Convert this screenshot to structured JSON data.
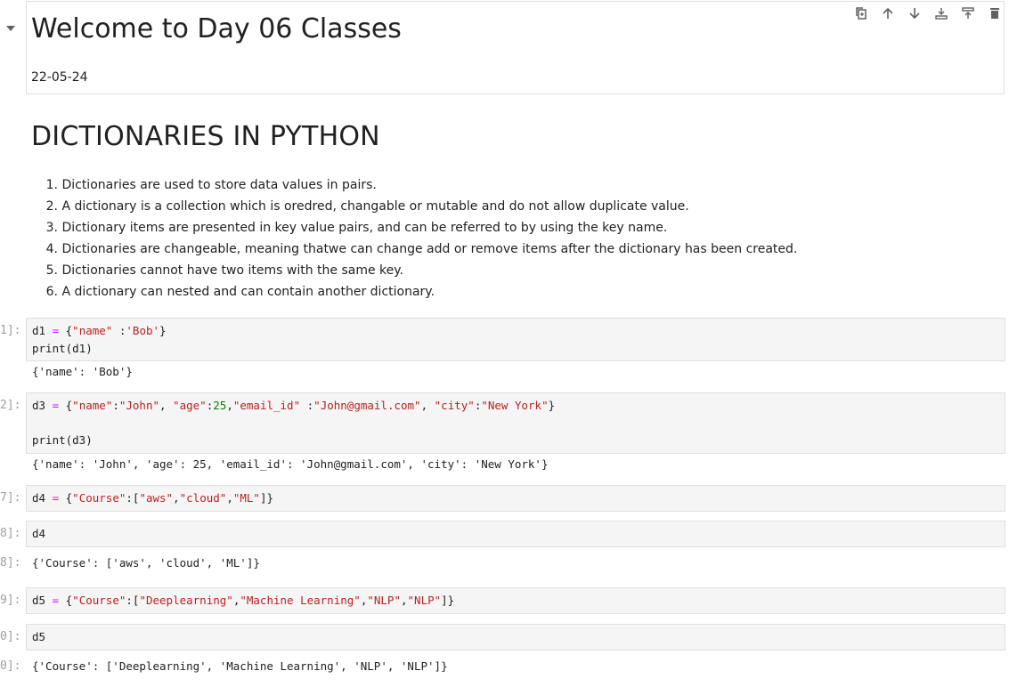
{
  "markdown_cell": {
    "title": "Welcome to Day 06 Classes",
    "date": "22-05-24"
  },
  "toolbar_icons": [
    "duplicate-icon",
    "move-up-icon",
    "move-down-icon",
    "insert-above-icon",
    "insert-below-icon",
    "delete-icon"
  ],
  "section": {
    "heading": "DICTIONARIES IN PYTHON",
    "points": [
      {
        "n": "1.",
        "text": "Dictionaries are used to store data values in pairs."
      },
      {
        "n": "2.",
        "text": "A dictionary is a collection which is oredred, changable or mutable and do not allow duplicate value."
      },
      {
        "n": "3.",
        "text": "Dictionary items are presented in key value pairs, and can be referred to by using the key name."
      },
      {
        "n": "4.",
        "text": "Dictionaries are changeable, meaning thatwe can change add or remove items after the dictionary has been created."
      },
      {
        "n": "5.",
        "text": "Dictionaries cannot have two items with the same key."
      },
      {
        "n": "6.",
        "text": "A dictionary can nested and can contain another dictionary."
      }
    ]
  },
  "cells": [
    {
      "prompt": "1]:",
      "out_prompt": "",
      "code": [
        [
          {
            "t": "d1 ",
            "c": "p"
          },
          {
            "t": "=",
            "c": "o"
          },
          {
            "t": " {",
            "c": "p"
          },
          {
            "t": "\"name\"",
            "c": "s"
          },
          {
            "t": " :",
            "c": "p"
          },
          {
            "t": "'Bob'",
            "c": "s"
          },
          {
            "t": "}",
            "c": "p"
          }
        ],
        [
          {
            "t": "print(d1)",
            "c": "p"
          }
        ]
      ],
      "output": "{'name': 'Bob'}"
    },
    {
      "prompt": "2]:",
      "out_prompt": "",
      "code": [
        [
          {
            "t": "d3 ",
            "c": "p"
          },
          {
            "t": "=",
            "c": "o"
          },
          {
            "t": " {",
            "c": "p"
          },
          {
            "t": "\"name\"",
            "c": "s"
          },
          {
            "t": ":",
            "c": "p"
          },
          {
            "t": "\"John\"",
            "c": "s"
          },
          {
            "t": ", ",
            "c": "p"
          },
          {
            "t": "\"age\"",
            "c": "s"
          },
          {
            "t": ":",
            "c": "p"
          },
          {
            "t": "25",
            "c": "n"
          },
          {
            "t": ",",
            "c": "p"
          },
          {
            "t": "\"email_id\"",
            "c": "s"
          },
          {
            "t": " :",
            "c": "p"
          },
          {
            "t": "\"John@gmail.com\"",
            "c": "s"
          },
          {
            "t": ", ",
            "c": "p"
          },
          {
            "t": "\"city\"",
            "c": "s"
          },
          {
            "t": ":",
            "c": "p"
          },
          {
            "t": "\"New York\"",
            "c": "s"
          },
          {
            "t": "}",
            "c": "p"
          }
        ],
        [],
        [
          {
            "t": "print(d3)",
            "c": "p"
          }
        ]
      ],
      "output": "{'name': 'John', 'age': 25, 'email_id': 'John@gmail.com', 'city': 'New York'}"
    },
    {
      "prompt": "7]:",
      "out_prompt": "",
      "code": [
        [
          {
            "t": "d4 ",
            "c": "p"
          },
          {
            "t": "=",
            "c": "o"
          },
          {
            "t": " {",
            "c": "p"
          },
          {
            "t": "\"Course\"",
            "c": "s"
          },
          {
            "t": ":[",
            "c": "p"
          },
          {
            "t": "\"aws\"",
            "c": "s"
          },
          {
            "t": ",",
            "c": "p"
          },
          {
            "t": "\"cloud\"",
            "c": "s"
          },
          {
            "t": ",",
            "c": "p"
          },
          {
            "t": "\"ML\"",
            "c": "s"
          },
          {
            "t": "]}",
            "c": "p"
          }
        ]
      ],
      "output": ""
    },
    {
      "prompt": "8]:",
      "out_prompt": "8]:",
      "code": [
        [
          {
            "t": "d4",
            "c": "p"
          }
        ]
      ],
      "output": "{'Course': ['aws', 'cloud', 'ML']}"
    },
    {
      "prompt": "9]:",
      "out_prompt": "",
      "code": [
        [
          {
            "t": "d5 ",
            "c": "p"
          },
          {
            "t": "=",
            "c": "o"
          },
          {
            "t": " {",
            "c": "p"
          },
          {
            "t": "\"Course\"",
            "c": "s"
          },
          {
            "t": ":[",
            "c": "p"
          },
          {
            "t": "\"Deeplearning\"",
            "c": "s"
          },
          {
            "t": ",",
            "c": "p"
          },
          {
            "t": "\"Machine Learning\"",
            "c": "s"
          },
          {
            "t": ",",
            "c": "p"
          },
          {
            "t": "\"NLP\"",
            "c": "s"
          },
          {
            "t": ",",
            "c": "p"
          },
          {
            "t": "\"NLP\"",
            "c": "s"
          },
          {
            "t": "]}",
            "c": "p"
          }
        ]
      ],
      "output": ""
    },
    {
      "prompt": "0]:",
      "out_prompt": "0]:",
      "code": [
        [
          {
            "t": "d5",
            "c": "p"
          }
        ]
      ],
      "output": "{'Course': ['Deeplearning', 'Machine Learning', 'NLP', 'NLP']}"
    }
  ]
}
